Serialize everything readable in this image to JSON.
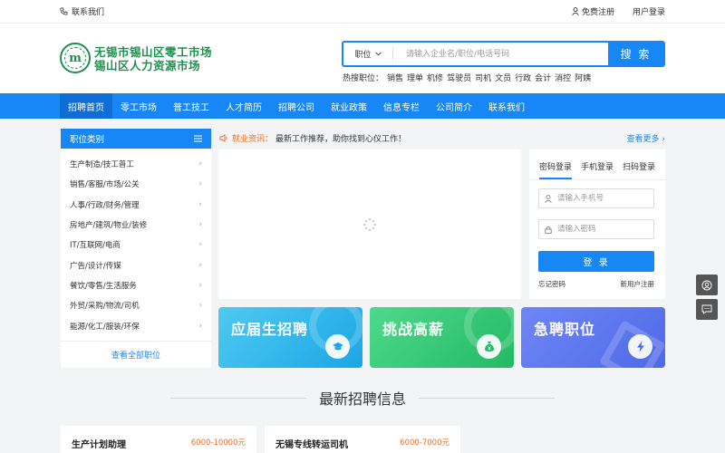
{
  "topbar": {
    "contact": "联系我们",
    "register": "免费注册",
    "login": "用户登录"
  },
  "logo": {
    "line1": "无锡市锡山区零工市场",
    "line2": "锡山区人力资源市场",
    "mark": "m"
  },
  "search": {
    "category": "职位",
    "placeholder": "请输入企业名/职位/电话号码",
    "button": "搜 索"
  },
  "hot": {
    "label": "热搜职位：",
    "items": [
      "销售",
      "理单",
      "机修",
      "驾驶员",
      "司机",
      "文员",
      "行政",
      "会计",
      "消控",
      "阿姨"
    ]
  },
  "nav": [
    "招聘首页",
    "零工市场",
    "普工技工",
    "人才简历",
    "招聘公司",
    "就业政策",
    "信息专栏",
    "公司简介",
    "联系我们"
  ],
  "categories": {
    "title": "职位类别",
    "items": [
      "生产制造/技工普工",
      "销售/客服/市场/公关",
      "人事/行政/财务/管理",
      "房地产/建筑/物业/装修",
      "IT/互联网/电商",
      "广告/设计/传媒",
      "餐饮/零售/生活服务",
      "外贸/采购/物流/司机",
      "能源/化工/服装/环保"
    ],
    "view_all": "查看全部职位"
  },
  "news": {
    "label": "就业资讯：",
    "text": "最新工作推荐，助你找到心仪工作！",
    "more": "查看更多"
  },
  "login_box": {
    "tabs": [
      "密码登录",
      "手机登录",
      "扫码登录"
    ],
    "phone_placeholder": "请输入手机号",
    "password_placeholder": "请输入密码",
    "button": "登 录",
    "forgot": "忘记密码",
    "register": "新用户注册"
  },
  "cards": [
    "应届生招聘",
    "挑战高薪",
    "急聘职位"
  ],
  "section_title": "最新招聘信息",
  "jobs": [
    {
      "name": "生产计划助理",
      "salary": "6000-10000元"
    },
    {
      "name": "无锡专线转运司机",
      "salary": "6000-7000元"
    }
  ],
  "colors": {
    "primary": "#1787f5",
    "accent": "#f26b21",
    "logo_green": "#1f8f4e"
  }
}
